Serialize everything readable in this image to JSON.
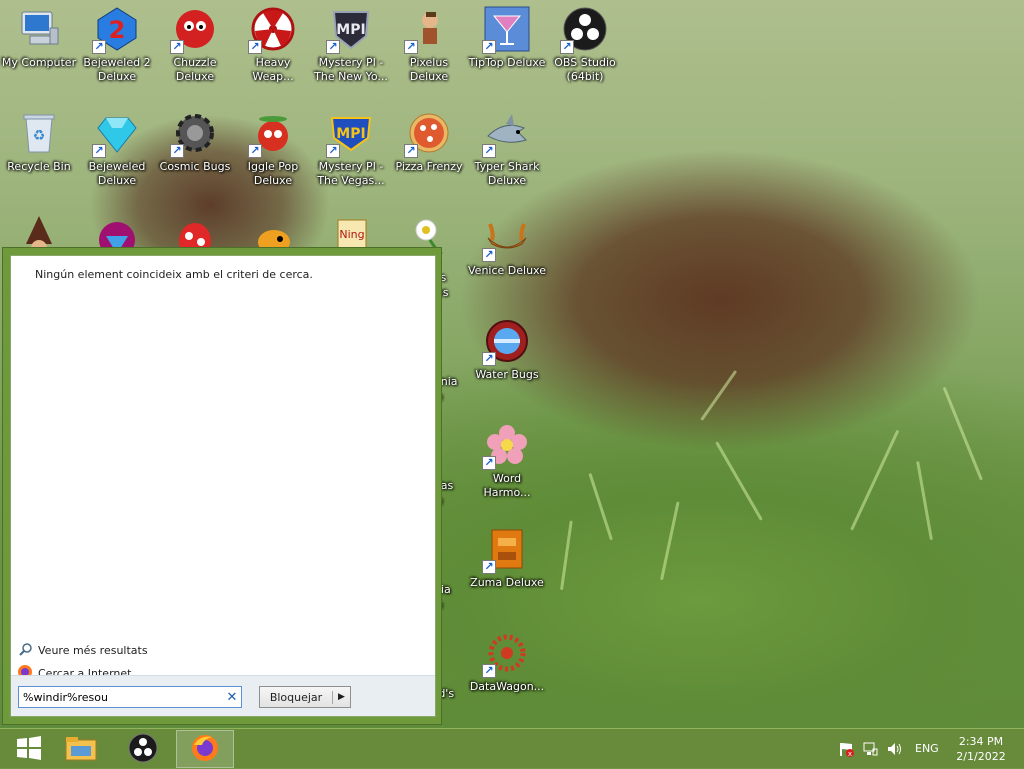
{
  "desktop": {
    "icons": [
      {
        "label": "My Computer",
        "icon": "computer-icon"
      },
      {
        "label": "Bejeweled 2 Deluxe",
        "icon": "bejeweled-2-icon"
      },
      {
        "label": "Chuzzle Deluxe",
        "icon": "chuzzle-icon"
      },
      {
        "label": "Heavy Weap...",
        "icon": "radiation-icon"
      },
      {
        "label": "Mystery PI - The New Yo...",
        "icon": "mystery-pi-icon"
      },
      {
        "label": "Pixelus Deluxe",
        "icon": "pixelus-icon"
      },
      {
        "label": "TipTop Deluxe",
        "icon": "cocktail-icon"
      },
      {
        "label": "OBS Studio (64bit)",
        "icon": "obs-icon"
      },
      {
        "label": "Recycle Bin",
        "icon": "recycle-bin-icon"
      },
      {
        "label": "Bejeweled Deluxe",
        "icon": "diamond-icon"
      },
      {
        "label": "Cosmic Bugs",
        "icon": "gear-icon"
      },
      {
        "label": "Iggle Pop Deluxe",
        "icon": "iggle-pop-icon"
      },
      {
        "label": "Mystery PI - The Vegas...",
        "icon": "mystery-pi-vegas-icon"
      },
      {
        "label": "Pizza Frenzy",
        "icon": "pizza-icon"
      },
      {
        "label": "Typer Shark Deluxe",
        "icon": "shark-icon"
      },
      {
        "label": "Venice Deluxe",
        "icon": "gondola-icon"
      },
      {
        "label": "Water Bugs",
        "icon": "porthole-icon"
      },
      {
        "label": "Word Harmo...",
        "icon": "flower-icon"
      },
      {
        "label": "Zuma Deluxe",
        "icon": "zuma-icon"
      },
      {
        "label": "DataWagon...",
        "icon": "datawagon-icon"
      }
    ],
    "partial_labels": [
      "ys",
      "es",
      "ania",
      "e",
      "eas",
      "e",
      "nia",
      "e",
      "rd's"
    ]
  },
  "start_menu": {
    "no_results_text": "Ningún element coincideix amb el criteri de cerca.",
    "more_results_label": "Veure més resultats",
    "search_internet_label": "Cercar a Internet",
    "search_value": "%windir%resou",
    "clear_symbol": "✕",
    "lock_button_label": "Bloquejar",
    "lock_arrow": "▶"
  },
  "taskbar": {
    "pinned": [
      "start-icon",
      "file-explorer-icon",
      "obs-icon",
      "firefox-icon"
    ],
    "tray": {
      "language": "ENG",
      "time": "2:34 PM",
      "date": "2/1/2022"
    }
  },
  "colors": {
    "taskbar": "#688a3c",
    "start_border": "#6e9a3c"
  }
}
